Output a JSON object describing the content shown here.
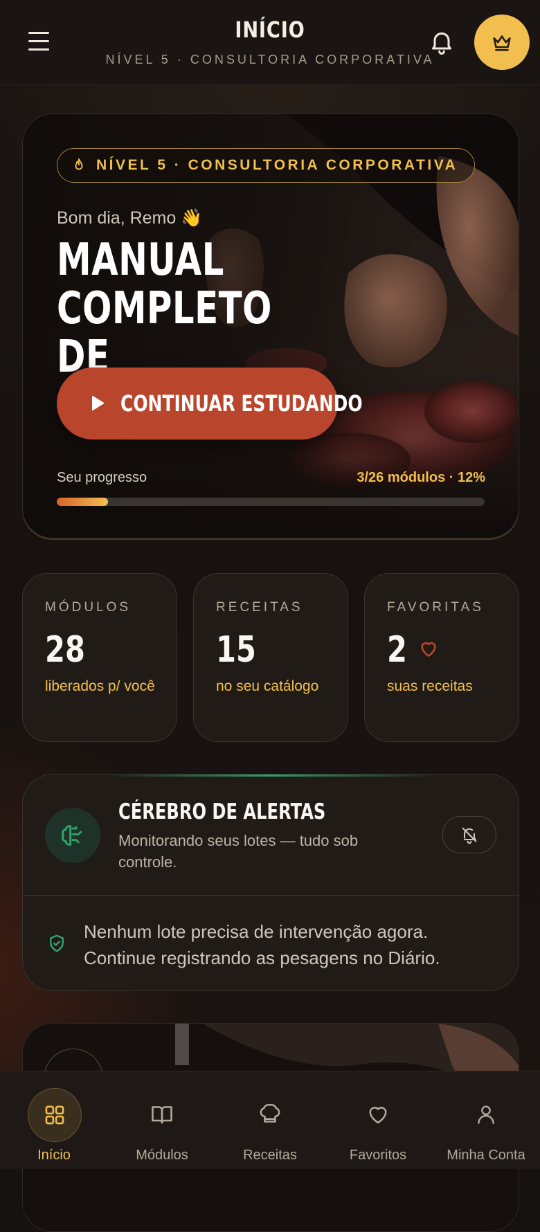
{
  "colors": {
    "accent_gold": "#f2bf4f",
    "cta": "#b9462c",
    "background": "#161210",
    "success_green": "#2ea26b"
  },
  "header": {
    "title": "INÍCIO",
    "subtitle": "NÍVEL 5 · CONSULTORIA CORPORATIVA",
    "menu_icon": "hamburger-menu-icon",
    "notification_icon": "bell-icon",
    "premium_icon": "crown-icon"
  },
  "hero": {
    "level_badge": "NÍVEL 5 · CONSULTORIA CORPORATIVA",
    "greeting": "Bom dia, Remo 👋",
    "title_line1": "MANUAL COMPLETO",
    "title_line2": "DE CHARCUTARIA",
    "cta_label": "CONTINUAR ESTUDANDO",
    "progress_label": "Seu progresso",
    "progress_count": "3/26 módulos · 12%",
    "progress_fraction": 0.12
  },
  "stats": [
    {
      "key": "MÓDULOS",
      "value": "28",
      "desc": "liberados p/ você"
    },
    {
      "key": "RECEITAS",
      "value": "15",
      "desc": "no seu catálogo"
    },
    {
      "key": "FAVORITAS",
      "value": "2",
      "desc": "suas receitas"
    }
  ],
  "alerts": {
    "title": "CÉREBRO DE ALERTAS",
    "subtitle": "Monitorando seus lotes — tudo sob controle.",
    "message": "Nenhum lote precisa de intervenção agora. Continue registrando as pesagens no Diário."
  },
  "nav": [
    {
      "label": "Início",
      "icon": "grid-icon",
      "active": true
    },
    {
      "label": "Módulos",
      "icon": "book-icon",
      "active": false
    },
    {
      "label": "Receitas",
      "icon": "chef-hat-icon",
      "active": false
    },
    {
      "label": "Favoritos",
      "icon": "heart-icon",
      "active": false
    },
    {
      "label": "Minha Conta",
      "icon": "user-icon",
      "active": false
    }
  ]
}
